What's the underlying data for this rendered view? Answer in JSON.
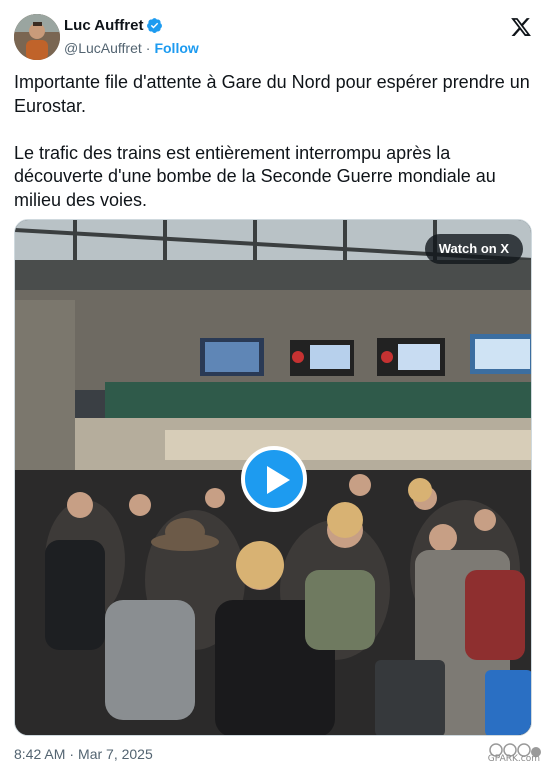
{
  "author": {
    "name": "Luc Auffret",
    "handle": "@LucAuffret",
    "separator": "·",
    "follow_label": "Follow",
    "verified": true
  },
  "tweet": {
    "paragraph_1": "Importante file d'attente à Gare du Nord pour espérer prendre un Eurostar.",
    "paragraph_2": "Le trafic des trains est entièrement interrompu après la découverte d'une bombe de la Seconde Guerre mondiale au milieu des voies."
  },
  "media": {
    "watch_label": "Watch on X",
    "play_icon": "play-icon"
  },
  "footer": {
    "time": "8:42 AM",
    "separator": "·",
    "date": "Mar 7, 2025"
  },
  "watermark": {
    "text": "GPARK.com"
  },
  "colors": {
    "accent": "#1d9bf0",
    "text": "#0f1419",
    "muted": "#536471"
  }
}
